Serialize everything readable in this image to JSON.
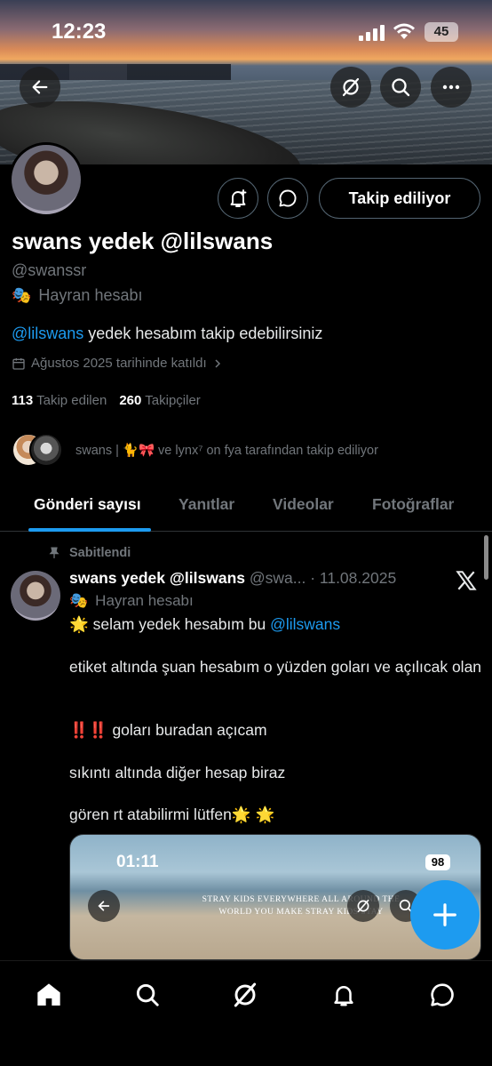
{
  "status_bar": {
    "time": "12:23",
    "battery": "45"
  },
  "header_actions": {
    "back": "back-arrow",
    "grok": "grok-icon",
    "search": "search-icon",
    "more": "more-icon"
  },
  "profile": {
    "follow_button": "Takip ediliyor",
    "display_name": "swans yedek @lilswans",
    "handle": "@swanssr",
    "label_emoji": "🎭",
    "label": "Hayran hesabı",
    "bio_mention": "@lilswans",
    "bio_text": " yedek hesabım takip edebilirsiniz",
    "joined": "Ağustos 2025 tarihinde katıldı",
    "following_count": "113",
    "following_label": "Takip edilen",
    "followers_count": "260",
    "followers_label": "Takipçiler",
    "followed_by": "swans | 🐈🎀 ve lynx⁷ on fya tarafından takip ediliyor"
  },
  "tabs": [
    {
      "label": "Gönderi sayısı",
      "active": true
    },
    {
      "label": "Yanıtlar",
      "active": false
    },
    {
      "label": "Videolar",
      "active": false
    },
    {
      "label": "Fotoğraflar",
      "active": false
    }
  ],
  "post": {
    "pinned_label": "Sabitlendi",
    "author": "swans yedek @lilswans",
    "meta": "@swa... · 11.08.2025",
    "label_emoji": "🎭",
    "label": "Hayran hesabı",
    "line1_prefix": "🌟 selam yedek hesabım bu ",
    "line1_mention": "@lilswans",
    "line2": "etiket altında şuan hesabım o yüzden goları ve açılıcak olan",
    "line3": "‼️‼️ goları buradan açıcam",
    "line4": "sıkıntı altında diğer hesap biraz",
    "line5": "gören rt atabilirmi lütfen🌟 🌟",
    "media": {
      "time": "01:11",
      "battery": "98",
      "caption": "STRAY KIDS EVERYWHERE ALL AROUND THE WORLD YOU MAKE STRAY KIDS STAY"
    }
  },
  "colors": {
    "accent": "#1d9bf0",
    "muted": "#71767b",
    "border": "#2f3336"
  }
}
